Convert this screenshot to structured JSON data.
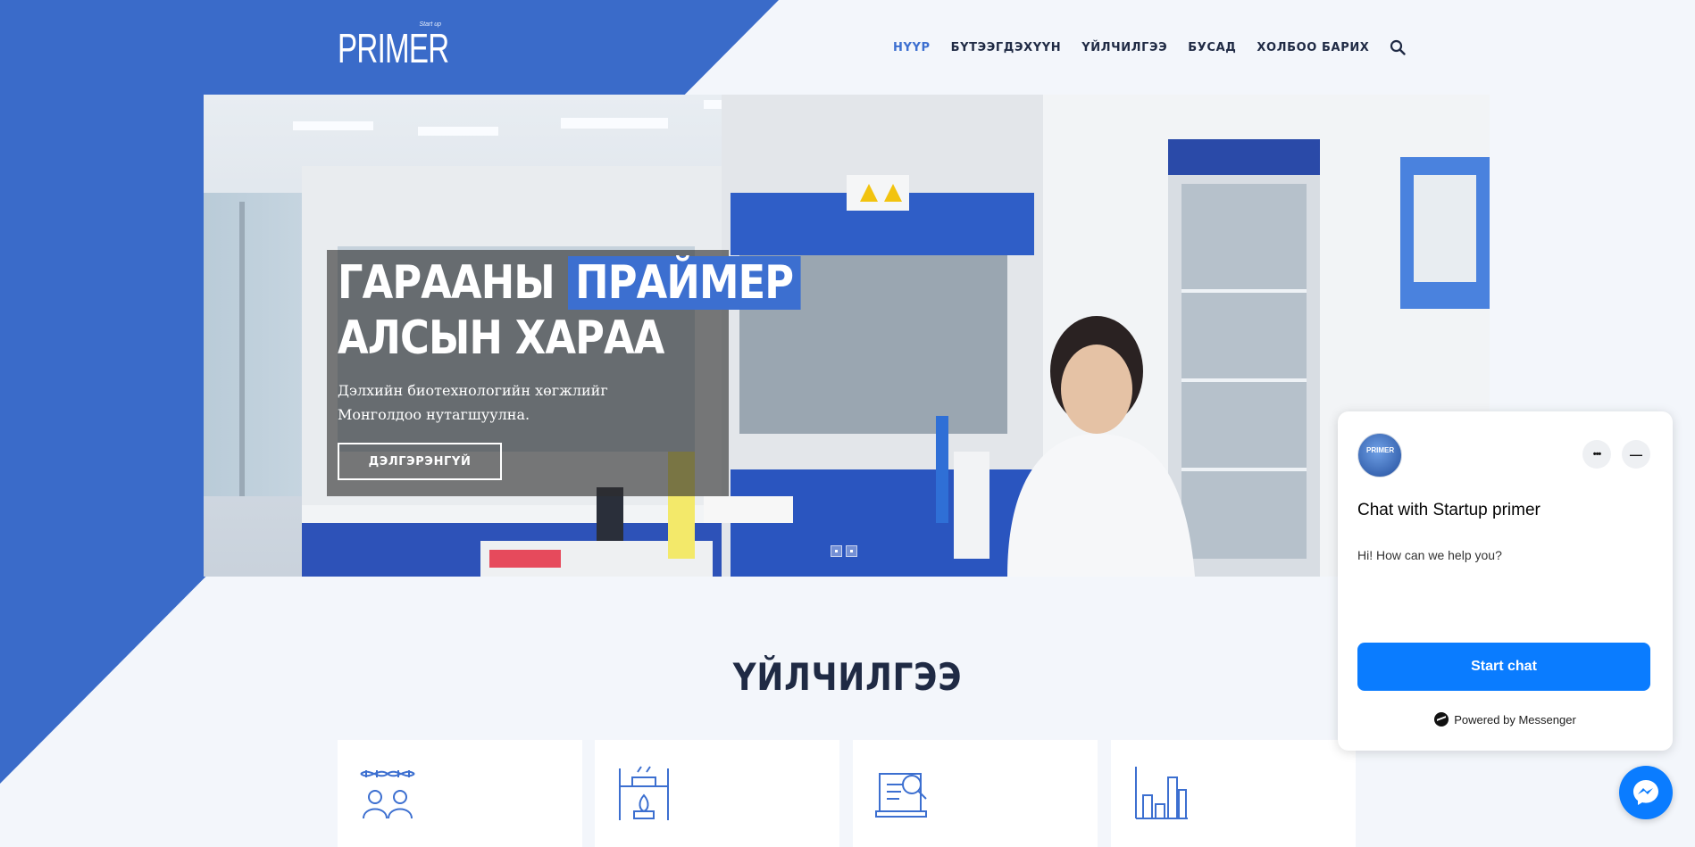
{
  "brand": {
    "logo_text": "PRIMER",
    "logo_tag": "Start up"
  },
  "nav": {
    "items": [
      {
        "label": "НҮҮР",
        "active": true
      },
      {
        "label": "БҮТЭЭГДЭХҮҮН",
        "active": false
      },
      {
        "label": "ҮЙЛЧИЛГЭЭ",
        "active": false
      },
      {
        "label": "БУСАД",
        "active": false
      },
      {
        "label": "ХОЛБОО БАРИХ",
        "active": false
      }
    ],
    "search_icon": "search-icon"
  },
  "hero": {
    "title_line1_plain": "ГАРААНЫ",
    "title_line1_highlight": "ПРАЙМЕР",
    "title_line2": "АЛСЫН ХАРАА",
    "description": "Дэлхийн биотехнологийн хөгжлийг Монголдоо нутагшуулна.",
    "button_label": "ДЭЛГЭРЭНГҮЙ",
    "slide_count": 2
  },
  "services": {
    "title": "ҮЙЛЧИЛГЭЭ",
    "cards": [
      {
        "icon": "dna-people-icon"
      },
      {
        "icon": "lab-burner-icon"
      },
      {
        "icon": "document-search-icon"
      },
      {
        "icon": "bar-chart-icon"
      }
    ]
  },
  "chat": {
    "title": "Chat with Startup primer",
    "message": "Hi! How can we help you?",
    "start_button": "Start chat",
    "powered_by": "Powered by Messenger",
    "more_label": "•••",
    "minimize_label": "—"
  },
  "colors": {
    "accent": "#3c6fd0",
    "messenger_blue": "#0a7cff",
    "page_bg": "#f3f6fb"
  }
}
